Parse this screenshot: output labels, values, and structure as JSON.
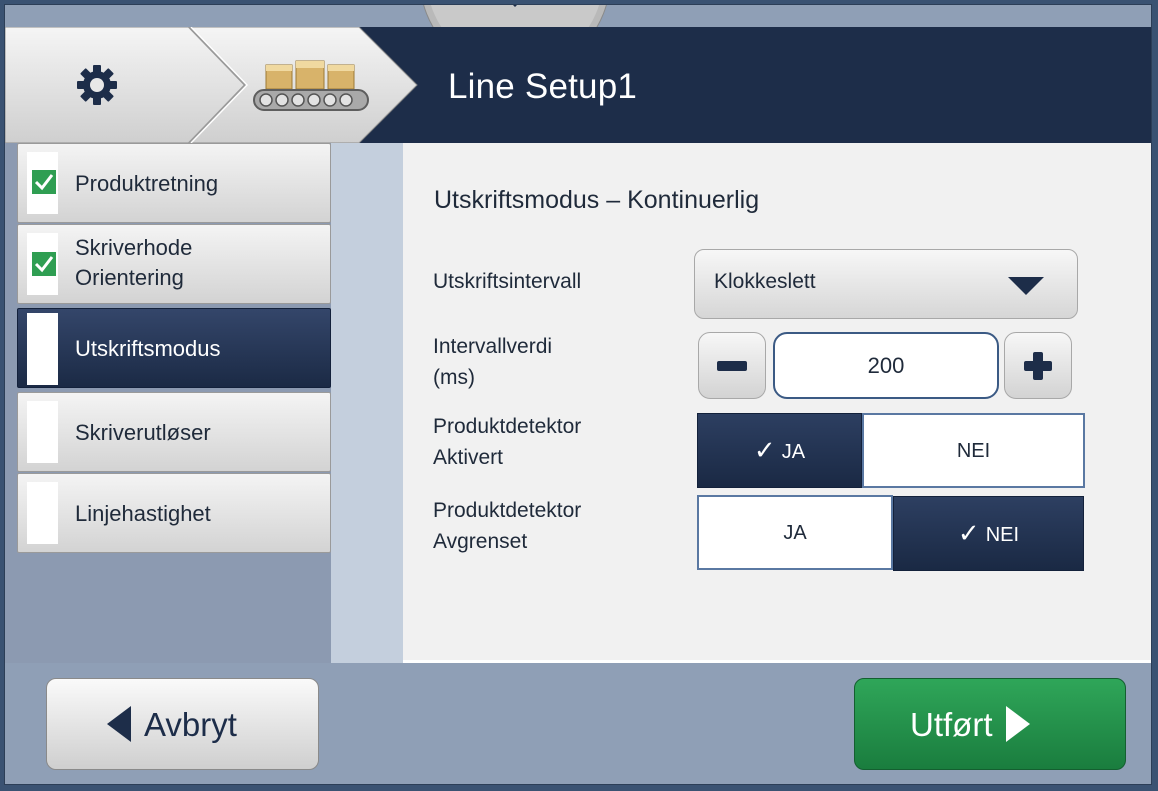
{
  "header": {
    "title": "Line Setup1",
    "breadcrumb": [
      {
        "icon": "gear-icon"
      },
      {
        "icon": "conveyor-icon"
      }
    ],
    "menu_tab_icon": "chevron-down-icon"
  },
  "sidebar": {
    "items": [
      {
        "label": "Produktretning",
        "status": "completed"
      },
      {
        "label": "Skriverhode\nOrientering",
        "status": "completed"
      },
      {
        "label": "Utskriftsmodus",
        "status": "active"
      },
      {
        "label": "Skriverutløser",
        "status": "pending"
      },
      {
        "label": "Linjehastighet",
        "status": "pending"
      }
    ]
  },
  "main": {
    "title": "Utskriftsmodus – Kontinuerlig",
    "print_interval": {
      "label": "Utskriftsintervall",
      "value": "Klokkeslett"
    },
    "interval_value": {
      "label": "Intervallverdi\n(ms)",
      "value": "200"
    },
    "detector_enabled": {
      "label": "Produktdetektor\nAktivert",
      "yes": "JA",
      "no": "NEI",
      "selected": "JA"
    },
    "detector_limited": {
      "label": "Produktdetektor\nAvgrenset",
      "yes": "JA",
      "no": "NEI",
      "selected": "NEI"
    }
  },
  "footer": {
    "cancel_label": "Avbryt",
    "done_label": "Utført"
  },
  "colors": {
    "header_bg": "#1d2d49",
    "check_green": "#2f9e52",
    "done_green": "#23924a",
    "toggle_selected": "#1d2d49",
    "toggle_border": "#5a78a2"
  }
}
